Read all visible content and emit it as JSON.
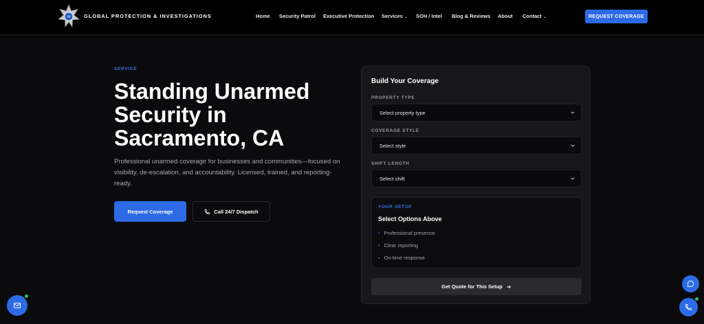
{
  "header": {
    "brand": "GLOBAL PROTECTION & INVESTIGATIONS",
    "menu": [
      {
        "label": "Home"
      },
      {
        "label": "Security Patrol"
      },
      {
        "label": "Executive Protection"
      },
      {
        "label": "Services"
      },
      {
        "label": "SOH / Intel"
      },
      {
        "label": "Blog & Reviews"
      },
      {
        "label": "About"
      },
      {
        "label": "Contact"
      }
    ],
    "cta_label": "REQUEST COVERAGE"
  },
  "hero": {
    "eyebrow": "SERVICE",
    "title": "Standing Unarmed Security in Sacramento, CA",
    "description": "Professional unarmed coverage for businesses and communities—focused on visibility, de-escalation, and accountability. Licensed, trained, and reporting-ready.",
    "primary_label": "Request Coverage",
    "secondary_label": "Call 24/7 Dispatch"
  },
  "builder": {
    "title": "Build Your Coverage",
    "fields": [
      {
        "label": "PROPERTY TYPE",
        "value": "Select property type"
      },
      {
        "label": "COVERAGE STYLE",
        "value": "Select style"
      },
      {
        "label": "SHIFT LENGTH",
        "value": "Select shift"
      }
    ],
    "setup": {
      "eyebrow": "YOUR SETUP",
      "title": "Select Options Above",
      "items": [
        "Professional presence",
        "Clear reporting",
        "On-time response"
      ]
    },
    "quote_label": "Get Quote for This Setup"
  },
  "colors": {
    "accent": "#2d6be6",
    "background": "#0b0b0d",
    "online": "#22c55e"
  },
  "icons": {
    "logo": "star-badge-icon",
    "phone": "phone-icon",
    "arrow": "arrow-right-icon",
    "mail": "mail-icon",
    "chat": "chat-icon",
    "chevron": "chevron-down-icon"
  }
}
